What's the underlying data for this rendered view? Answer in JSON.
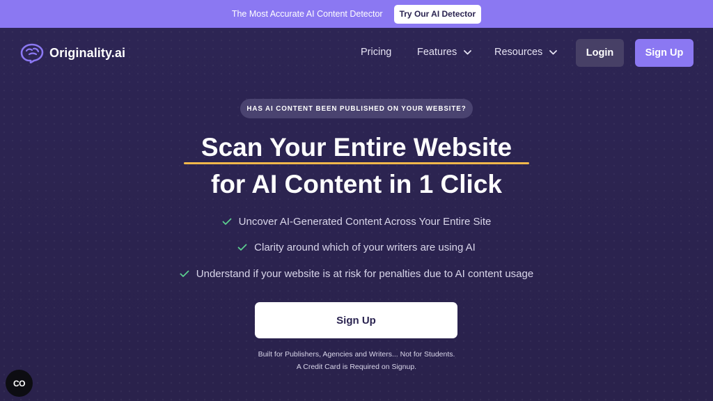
{
  "announcement": {
    "text": "The Most Accurate AI Content Detector",
    "button_label": "Try Our AI Detector"
  },
  "nav": {
    "brand": "Originality.ai",
    "logo_icon": "brain-icon",
    "links": [
      {
        "label": "Pricing",
        "has_dropdown": false
      },
      {
        "label": "Features",
        "has_dropdown": true
      },
      {
        "label": "Resources",
        "has_dropdown": true
      }
    ],
    "login_label": "Login",
    "signup_label": "Sign Up"
  },
  "hero": {
    "eyebrow": "HAS AI CONTENT BEEN PUBLISHED ON YOUR WEBSITE?",
    "headline_line1": "Scan Your Entire Website",
    "headline_line2": "for AI Content in 1 Click",
    "benefits": [
      "Uncover AI-Generated Content Across Your Entire Site",
      "Clarity around which of your writers are using AI",
      "Understand if your website is at risk for penalties due to AI content usage"
    ],
    "cta_label": "Sign Up",
    "note_line1": "Built for Publishers, Agencies and Writers... Not for Students.",
    "note_line2": "A Credit Card is Required on Signup."
  },
  "widget": {
    "label": "CO"
  },
  "colors": {
    "accent": "#8b78f2",
    "background": "#2a2350",
    "underline": "#f2b84b",
    "check": "#5ccf8f"
  }
}
